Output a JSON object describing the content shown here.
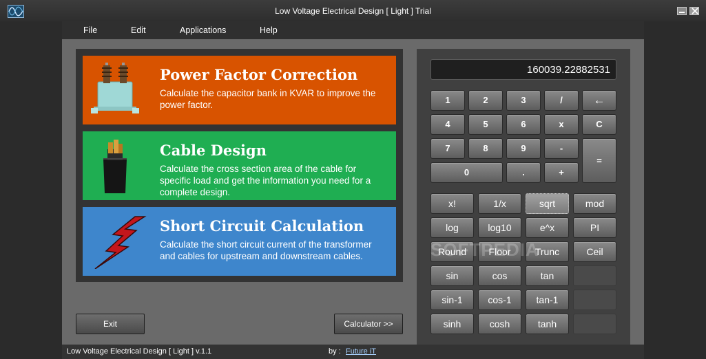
{
  "window": {
    "title": "Low Voltage Electrical Design [ Light ] Trial"
  },
  "menu": [
    "File",
    "Edit",
    "Applications",
    "Help"
  ],
  "tiles": [
    {
      "title": "Power Factor Correction",
      "description": "Calculate the capacitor bank in KVAR to improve the power factor.",
      "color": "#d85300"
    },
    {
      "title": "Cable Design",
      "description": "Calculate the cross section area of the cable for specific load and get the information you need for a complete design.",
      "color": "#1fae52"
    },
    {
      "title": "Short Circuit Calculation",
      "description": "Calculate the short circuit current of the transformer and cables for upstream and downstream cables.",
      "color": "#3e86cc"
    }
  ],
  "buttons": {
    "exit": "Exit",
    "calculator": "Calculator  >>"
  },
  "calculator": {
    "display": "160039.22882531",
    "keys": {
      "k1": "1",
      "k2": "2",
      "k3": "3",
      "div": "/",
      "back": "←",
      "k4": "4",
      "k5": "5",
      "k6": "6",
      "mul": "x",
      "clear": "C",
      "k7": "7",
      "k8": "8",
      "k9": "9",
      "sub": "-",
      "eq": "=",
      "k0": "0",
      "dot": ".",
      "add": "+"
    },
    "functions": [
      [
        "x!",
        "1/x",
        "sqrt",
        "mod"
      ],
      [
        "log",
        "log10",
        "e^x",
        "PI"
      ],
      [
        "Round",
        "Floor",
        "Trunc",
        "Ceil"
      ],
      [
        "sin",
        "cos",
        "tan",
        ""
      ],
      [
        "sin-1",
        "cos-1",
        "tan-1",
        ""
      ],
      [
        "sinh",
        "cosh",
        "tanh",
        ""
      ]
    ]
  },
  "watermark": "SOFTPEDIA",
  "status": {
    "title": "Low Voltage Electrical Design [ Light ]  v.1.1",
    "by": "by :",
    "link": "Future iT"
  }
}
